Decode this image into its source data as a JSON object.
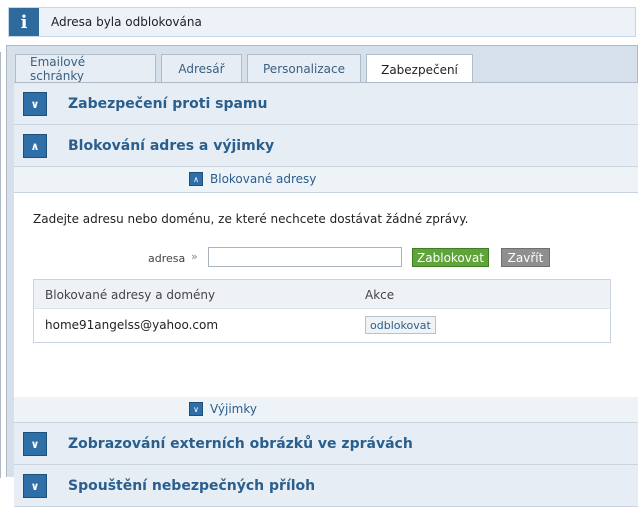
{
  "notice": {
    "icon": "info-icon",
    "text": "Adresa byla odblokována"
  },
  "tabs": [
    {
      "label": "Emailové schránky",
      "active": false
    },
    {
      "label": "Adresář",
      "active": false
    },
    {
      "label": "Personalizace",
      "active": false
    },
    {
      "label": "Zabezpečení",
      "active": true
    }
  ],
  "sections": {
    "spam": {
      "title": "Zabezpečení proti spamu",
      "expanded": false
    },
    "blocking": {
      "title": "Blokování adres a výjimky",
      "expanded": true
    },
    "images": {
      "title": "Zobrazování externích obrázků ve zprávách",
      "expanded": false
    },
    "attachments": {
      "title": "Spouštění nebezpečných příloh",
      "expanded": false
    }
  },
  "blocked": {
    "header": "Blokované adresy",
    "description": "Zadejte adresu nebo doménu, ze které nechcete dostávat žádné zprávy.",
    "address_label": "adresa",
    "address_value": "",
    "block_button": "Zablokovat",
    "close_button": "Zavřít",
    "table": {
      "columns": [
        "Blokované adresy a domény",
        "Akce"
      ],
      "rows": [
        {
          "address": "home91angelss@yahoo.com",
          "action": "odblokovat"
        }
      ]
    }
  },
  "exceptions": {
    "header": "Výjimky"
  },
  "colors": {
    "accent": "#2f6fa7",
    "block_button": "#5ea43b",
    "close_button": "#8f8f8f"
  }
}
